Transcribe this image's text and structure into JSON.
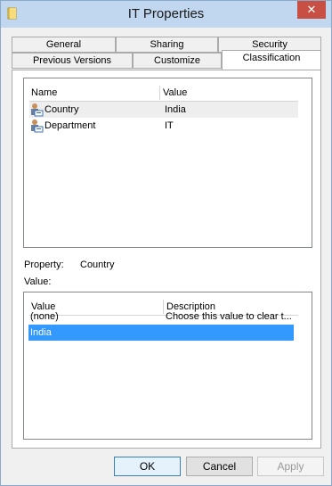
{
  "window": {
    "title": "IT Properties",
    "close_glyph": "✕"
  },
  "tabs": {
    "row_back": [
      "General",
      "Sharing",
      "Security"
    ],
    "row_front": [
      "Previous Versions",
      "Customize",
      "Classification"
    ],
    "active": "Classification"
  },
  "properties_list": {
    "columns": [
      "Name",
      "Value"
    ],
    "rows": [
      {
        "name": "Country",
        "value": "India",
        "icon": "property-icon"
      },
      {
        "name": "Department",
        "value": "IT",
        "icon": "property-icon"
      }
    ]
  },
  "property_label": "Property:",
  "property_value": "Country",
  "value_label": "Value:",
  "values_list": {
    "columns": [
      "Value",
      "Description"
    ],
    "rows": [
      {
        "value": "(none)",
        "description": "Choose this value to clear t..."
      },
      {
        "value": "India",
        "description": ""
      }
    ]
  },
  "buttons": {
    "ok": "OK",
    "cancel": "Cancel",
    "apply": "Apply"
  }
}
